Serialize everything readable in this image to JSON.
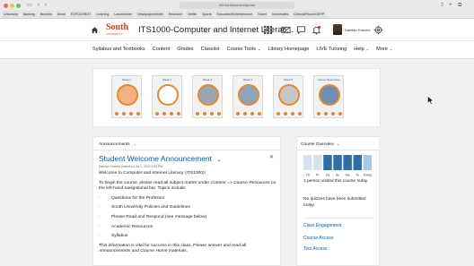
{
  "browser": {
    "url": "d2l.southuniversity.edu",
    "bookmarks": [
      "University",
      "Banking",
      "Benefits",
      "Email",
      "ESPOCHBOT",
      "Learning",
      "Lawinformer",
      "Newspaperinfinite",
      "Research",
      "Netflix",
      "Sports",
      "Education/Entertainment",
      "Travel",
      "Universities",
      "OutlookPhone/GRPP"
    ]
  },
  "header": {
    "logo_text": "South",
    "logo_sub": "UNIVERSITY",
    "course_title": "ITS1000-Computer and Internet Literac...",
    "user_name": "Damian Kravetz"
  },
  "nav": {
    "items": [
      {
        "label": "Syllabus and Textbooks"
      },
      {
        "label": "Content"
      },
      {
        "label": "Grades"
      },
      {
        "label": "Classlist"
      },
      {
        "label": "Course Tools",
        "dropdown": true
      },
      {
        "label": "Library Homepage"
      },
      {
        "label": "LIVE Tutoring"
      },
      {
        "label": "Help",
        "dropdown": true
      },
      {
        "label": "More",
        "dropdown": true
      }
    ]
  },
  "banner": {
    "cards": [
      {
        "label": "Week 1",
        "circle_color": "#f4b183"
      },
      {
        "label": "Week 2",
        "circle_color": "#ffffff"
      },
      {
        "label": "Week 3",
        "circle_color": "#9aa6b2"
      },
      {
        "label": "Week 4",
        "circle_color": "#8fa3b8"
      },
      {
        "label": "Week 5",
        "circle_color": "#c6c6c6"
      },
      {
        "label": "Course Resources",
        "circle_color": "#6f8fb5"
      }
    ]
  },
  "announcements": {
    "heading": "Announcements",
    "title": "Student Welcome Announcement",
    "meta": "Damian Kravetz posted on Jul 1, 2022 2:50 PM",
    "p1": "Welcome to Computer and Internet Literacy (ITS1000)!",
    "p2_a": "To begin the course, please read all subject matter under ",
    "p2_em1": "Content => Course Resources",
    "p2_b": " on the left-hand navigational bar.  Topics include:",
    "bullets": [
      "Questions for the Professor",
      "South University Policies and Guidelines",
      "Please Read and Respond (see message below)",
      "Academic Resources",
      "Syllabus"
    ],
    "p3_a": "This information is vital for success in this class. Please answer and read all ",
    "p3_em1": "Announcements",
    "p3_b": " and ",
    "p3_em2": "Course Home",
    "p3_c": " materials."
  },
  "overview": {
    "heading": "Course Overview",
    "text1": "1 person visited this course today.",
    "text2": "No quizzes have been submitted today.",
    "links": [
      "Class Engagement",
      "Course Access",
      "Tool Access"
    ]
  },
  "chart_data": {
    "type": "bar",
    "categories": [
      "Th",
      "Fr",
      "Sa",
      "Su",
      "Mo",
      "Tu",
      "Today"
    ],
    "values": [
      0,
      0,
      1,
      1,
      1,
      1,
      1
    ],
    "colors": [
      "#d5e3f0",
      "#d5e3f0",
      "#2f6fa8",
      "#2f6fa8",
      "#2f6fa8",
      "#2f6fa8",
      "#a9c9e6"
    ],
    "title": "",
    "xlabel": "",
    "ylabel": ""
  },
  "colors": {
    "accent": "#005fa3",
    "brand": "#c1441d",
    "banner_ring": "#e58a2f"
  }
}
